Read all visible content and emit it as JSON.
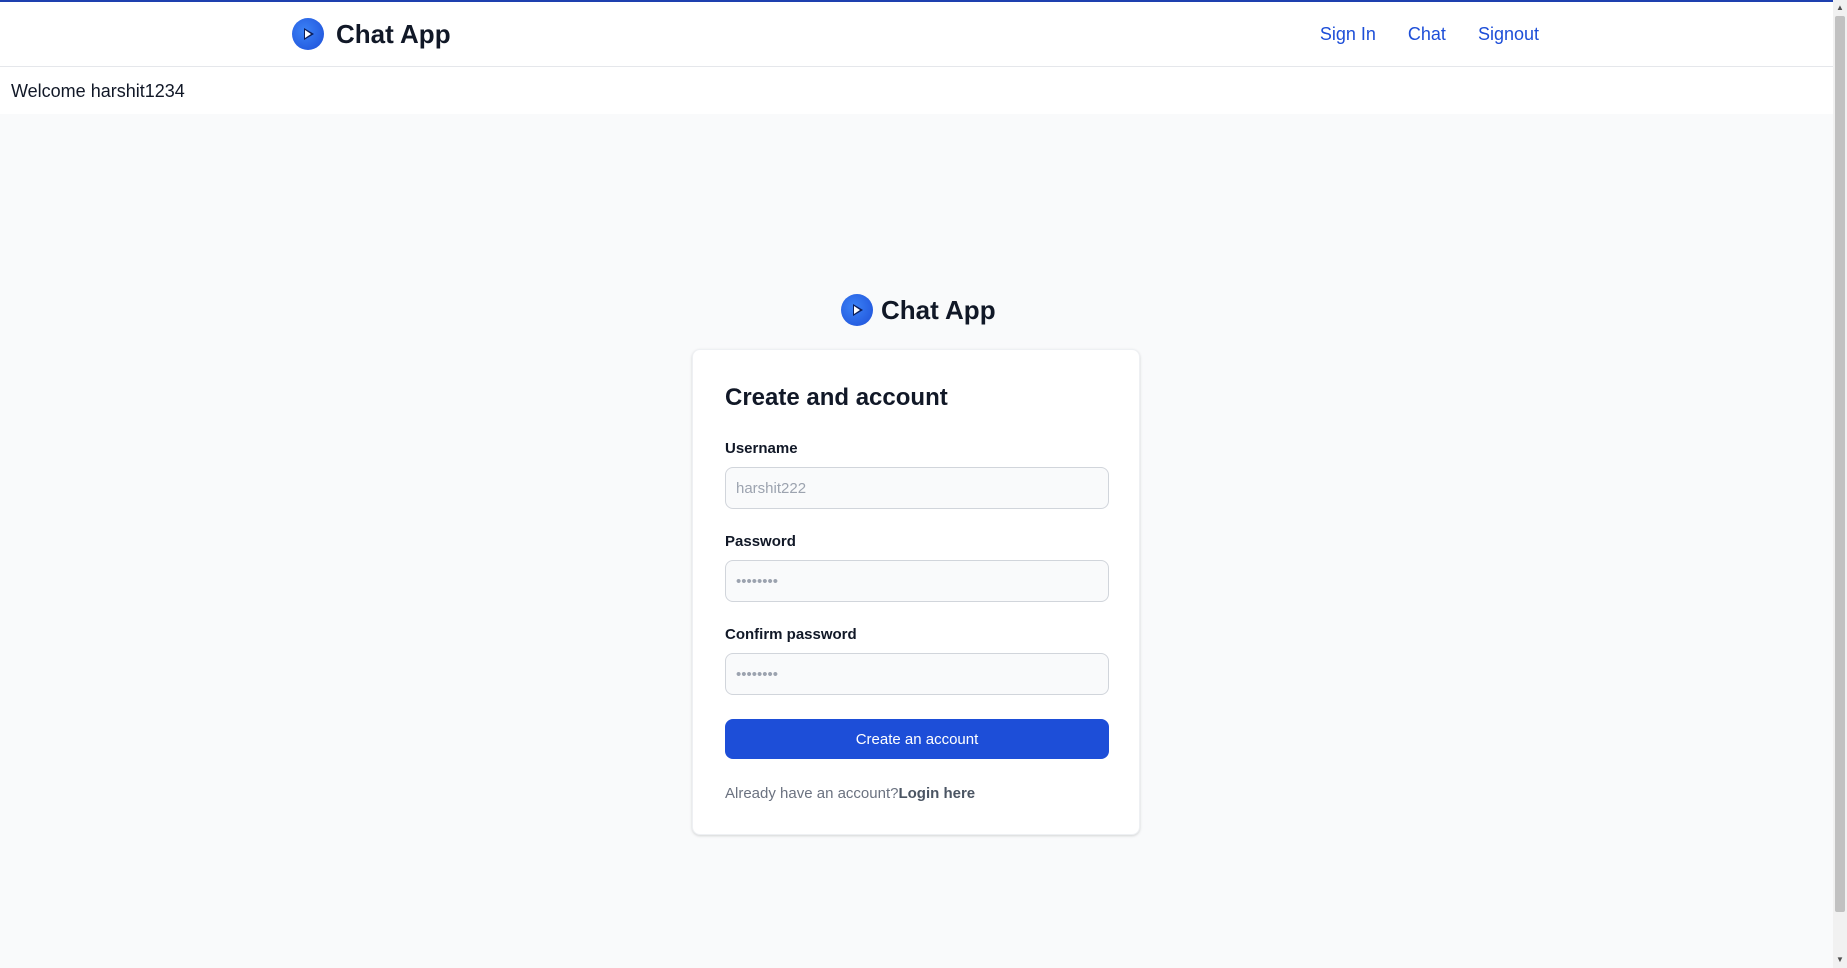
{
  "navbar": {
    "brand": "Chat App",
    "links": [
      {
        "label": "Sign In"
      },
      {
        "label": "Chat"
      },
      {
        "label": "Signout"
      }
    ]
  },
  "welcome": "Welcome harshit1234",
  "form": {
    "brand": "Chat App",
    "title": "Create and account",
    "username_label": "Username",
    "username_placeholder": "harshit222",
    "password_label": "Password",
    "password_placeholder": "••••••••",
    "confirm_label": "Confirm password",
    "confirm_placeholder": "••••••••",
    "submit_label": "Create an account",
    "footer_text": "Already have an account?",
    "footer_link": "Login here"
  },
  "colors": {
    "accent": "#1d4ed8",
    "top_line": "#1e40af",
    "background": "#f9fafb"
  },
  "icons": {
    "logo": "play-circle-icon",
    "scroll_up": "scroll-up-arrow-icon",
    "scroll_down": "scroll-down-arrow-icon"
  }
}
